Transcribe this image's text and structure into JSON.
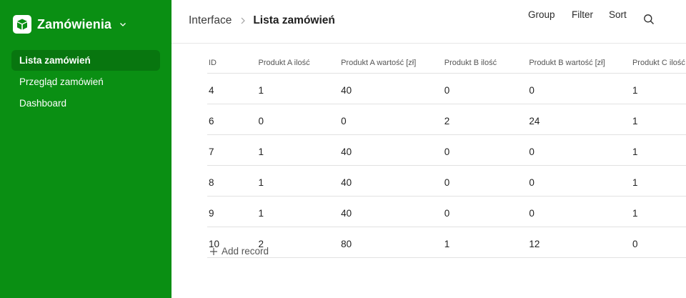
{
  "app": {
    "name": "Zamówienia",
    "logo_icon": "cube-icon",
    "accent": "#0a8f13",
    "accent_active": "#08760f"
  },
  "sidebar": {
    "items": [
      {
        "label": "Lista zamówień",
        "active": true
      },
      {
        "label": "Przegląd zamówień",
        "active": false
      },
      {
        "label": "Dashboard",
        "active": false
      }
    ]
  },
  "breadcrumb": {
    "root": "Interface",
    "current": "Lista zamówień"
  },
  "toolbar": {
    "group_label": "Group",
    "filter_label": "Filter",
    "sort_label": "Sort",
    "search_icon": "search-icon"
  },
  "table": {
    "columns": [
      "ID",
      "Produkt A ilość",
      "Produkt A wartość [zł]",
      "Produkt B ilość",
      "Produkt B wartość [zł]",
      "Produkt C ilość"
    ],
    "rows": [
      [
        "4",
        "1",
        "40",
        "0",
        "0",
        "1"
      ],
      [
        "6",
        "0",
        "0",
        "2",
        "24",
        "1"
      ],
      [
        "7",
        "1",
        "40",
        "0",
        "0",
        "1"
      ],
      [
        "8",
        "1",
        "40",
        "0",
        "0",
        "1"
      ],
      [
        "9",
        "1",
        "40",
        "0",
        "0",
        "1"
      ],
      [
        "10",
        "2",
        "80",
        "1",
        "12",
        "0"
      ]
    ]
  },
  "add_record_label": "Add record"
}
